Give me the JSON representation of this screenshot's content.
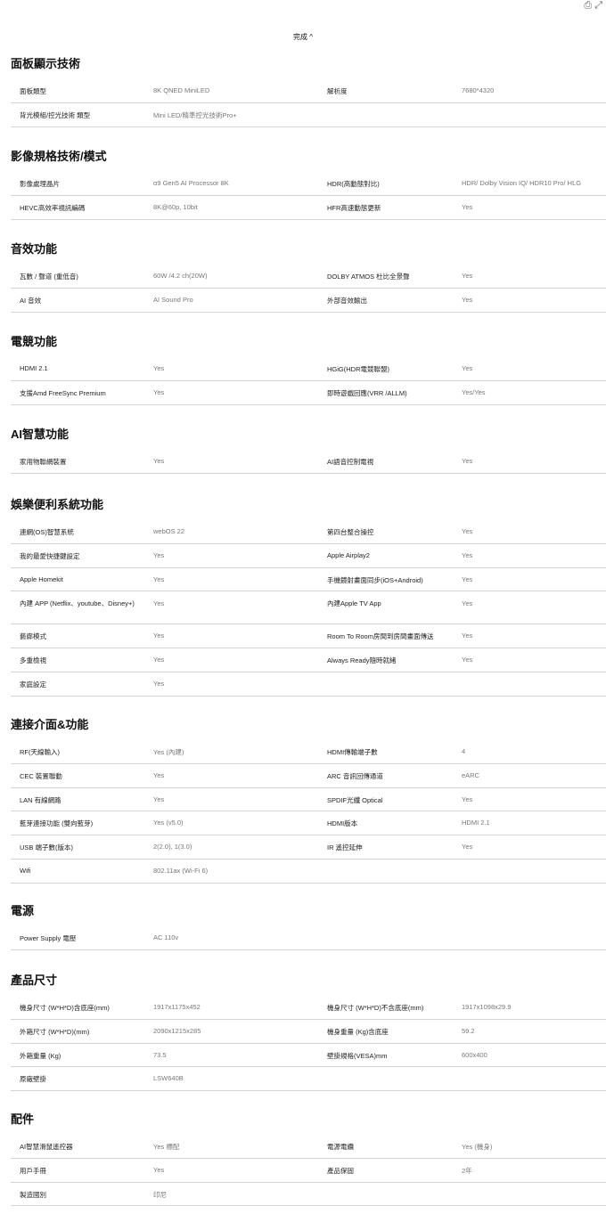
{
  "top_icons": "⎙ ⤢",
  "collapse_label": "完成 ^",
  "sections": [
    {
      "title": "面板顯示技術",
      "rows": [
        [
          "面板類型",
          "8K QNED MiniLED",
          "解析度",
          "7680*4320"
        ],
        [
          "背光模組/控光技術 類型",
          "Mini LED/精準控光技術Pro+",
          "",
          ""
        ]
      ]
    },
    {
      "title": "影像規格技術/模式",
      "rows": [
        [
          "影像處理晶片",
          "α9 Gen5 AI Processor 8K",
          "HDR(高動態對比)",
          "HDR/ Dolby Vision IQ/ HDR10 Pro/ HLG"
        ],
        [
          "HEVC高效率視訊編碼",
          "8K@60p, 10bit",
          "HFR高速動態更新",
          "Yes"
        ]
      ]
    },
    {
      "title": "音效功能",
      "rows": [
        [
          "瓦數 / 聲道 (重低音)",
          "60W /4.2 ch(20W)",
          "DOLBY ATMOS 杜比全景聲",
          "Yes"
        ],
        [
          "AI 音效",
          "AI Sound Pro",
          "外部音效輸出",
          "Yes"
        ]
      ]
    },
    {
      "title": "電競功能",
      "rows": [
        [
          "HDMI 2.1",
          "Yes",
          "HGiG(HDR電競聯盟)",
          "Yes"
        ],
        [
          "支援Amd FreeSync Premium",
          "Yes",
          "即時遊戲回應(VRR /ALLM)",
          "Yes/Yes"
        ]
      ]
    },
    {
      "title": "AI智慧功能",
      "rows": [
        [
          "家用物聯網裝置",
          "Yes",
          "AI語音控制電視",
          "Yes"
        ]
      ]
    },
    {
      "title": "娛樂便利系統功能",
      "rows": [
        [
          "連網(OS)智慧系統",
          "webOS 22",
          "第四台整合操控",
          "Yes"
        ],
        [
          "我的最愛快捷鍵設定",
          "Yes",
          "Apple Airplay2",
          "Yes"
        ],
        [
          "Apple Homekit",
          "Yes",
          "手機鏡射畫面同步(iOS+Android)",
          "Yes"
        ],
        [
          "內建 APP (Netflix、youtube、Disney+)",
          "Yes",
          "內建Apple TV App",
          "Yes"
        ],
        [
          "藝廊模式",
          "Yes",
          "Room To Room房間到房間畫面傳送",
          "Yes"
        ],
        [
          "多重檢視",
          "Yes",
          "Always Ready隨時就緒",
          "Yes"
        ],
        [
          "家庭設定",
          "Yes",
          "",
          ""
        ]
      ]
    },
    {
      "title": "連接介面&功能",
      "rows": [
        [
          "RF(天線輸入)",
          "Yes (內建)",
          "HDMI傳輸端子數",
          "4"
        ],
        [
          "CEC 裝置聯動",
          "Yes",
          "ARC 音訊回傳通道",
          "eARC"
        ],
        [
          "LAN 有線網路",
          "Yes",
          "SPDIF光纖 Optical",
          "Yes"
        ],
        [
          "藍芽連接功能 (雙向藍芽)",
          "Yes (v5.0)",
          "HDMI版本",
          "HDMI 2.1"
        ],
        [
          "USB 端子數(版本)",
          "2(2.0), 1(3.0)",
          "IR 遙控延伸",
          "Yes"
        ],
        [
          "Wifi",
          "802.11ax (Wi-Fi 6)",
          "",
          ""
        ]
      ]
    },
    {
      "title": "電源",
      "rows": [
        [
          "Power Supply 電壓",
          "AC 110v",
          "",
          ""
        ]
      ]
    },
    {
      "title": "產品尺寸",
      "rows": [
        [
          "機身尺寸 (W*H*D)含底座(mm)",
          "1917x1175x452",
          "機身尺寸 (W*H*D)不含底座(mm)",
          "1917x1098x29.9"
        ],
        [
          "外箱尺寸 (W*H*D)(mm)",
          "2090x1215x285",
          "機身重量 (Kg)含底座",
          "59.2"
        ],
        [
          "外箱重量 (Kg)",
          "73.5",
          "壁掛規格(VESA)mm",
          "600x400"
        ],
        [
          "原廠壁掛",
          "LSW640B",
          "",
          ""
        ]
      ]
    },
    {
      "title": "配件",
      "rows": [
        [
          "AI智慧滑鼠遙控器",
          "Yes 標配",
          "電源電纜",
          "Yes (機身)"
        ],
        [
          "用戶手冊",
          "Yes",
          "產品保固",
          "2年"
        ],
        [
          "製造國別",
          "印尼",
          "",
          ""
        ]
      ]
    }
  ]
}
